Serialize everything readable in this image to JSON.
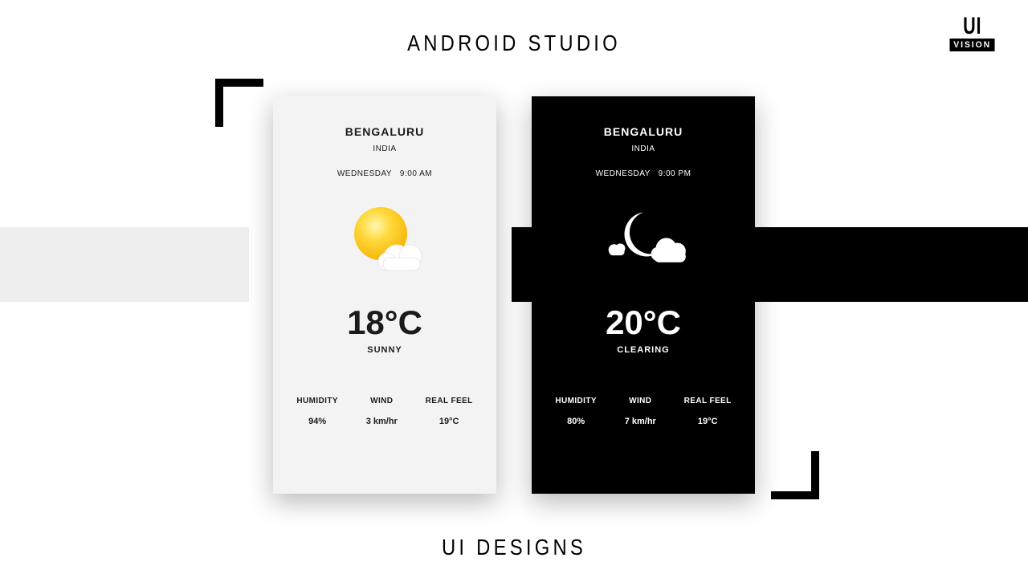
{
  "header": {
    "title": "ANDROID STUDIO",
    "footer": "UI DESIGNS",
    "logo_top": "UI",
    "logo_bottom": "VISION"
  },
  "cards": {
    "light": {
      "city": "BENGALURU",
      "country": "INDIA",
      "day": "WEDNESDAY",
      "time": "9:00 AM",
      "temp": "18°C",
      "condition": "SUNNY",
      "humidity_label": "HUMIDITY",
      "humidity_value": "94%",
      "wind_label": "WIND",
      "wind_value": "3 km/hr",
      "realfeel_label": "REAL FEEL",
      "realfeel_value": "19°C",
      "icon": "sun-cloud-icon"
    },
    "dark": {
      "city": "BENGALURU",
      "country": "INDIA",
      "day": "WEDNESDAY",
      "time": "9:00 PM",
      "temp": "20°C",
      "condition": "CLEARING",
      "humidity_label": "HUMIDITY",
      "humidity_value": "80%",
      "wind_label": "WIND",
      "wind_value": "7 km/hr",
      "realfeel_label": "REAL FEEL",
      "realfeel_value": "19°C",
      "icon": "moon-cloud-icon"
    }
  }
}
